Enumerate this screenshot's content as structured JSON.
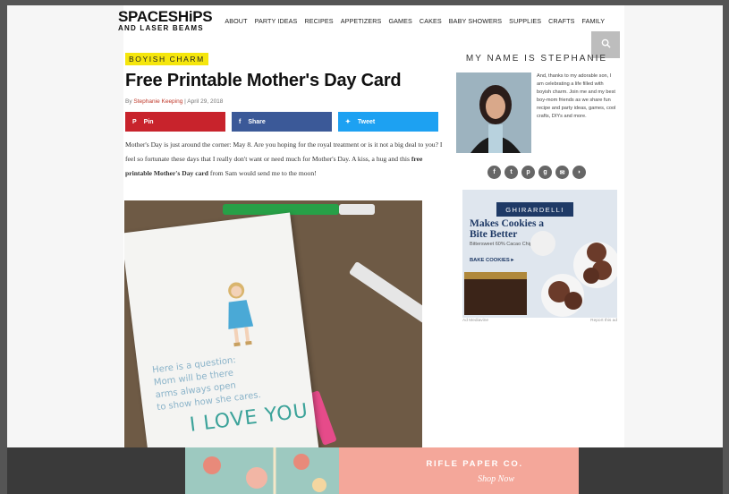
{
  "header": {
    "logo_top": "SPACESHiPS",
    "logo_bottom": "AND LASER BEAMS",
    "nav": [
      "ABOUT",
      "PARTY IDEAS",
      "RECIPES",
      "APPETIZERS",
      "GAMES",
      "CAKES",
      "BABY SHOWERS",
      "SUPPLIES",
      "CRAFTS",
      "FAMILY"
    ]
  },
  "post": {
    "category": "BOYISH CHARM",
    "title": "Free Printable Mother's Day Card",
    "byline_prefix": "By",
    "author": "Stephanie Keeping",
    "date": "April 29, 2018",
    "share": {
      "pin": "Pin",
      "share": "Share",
      "tweet": "Tweet"
    },
    "body_part1": "Mother's Day is just around the corner: May 8. Are you hoping for the royal treatment or is it not a big deal to you?  I feel so fortunate these days that I really don't want or need much for Mother's Day. A kiss, a hug and this ",
    "body_bold": "free printable Mother's Day card",
    "body_part2": " from Sam would send me to the moon!",
    "card_lines": [
      "Here is a question:",
      "Mom will be there",
      "arms always open",
      "to show how she cares."
    ],
    "card_love": "I LOVE YOU"
  },
  "sidebar": {
    "title": "MY NAME IS STEPHANIE",
    "about": "And, thanks to my adorable son, I am celebrating a life filled with boyish charm. Join me and my best boy-mom friends as we share fun recipe and party ideas, games, cool crafts, DIYs and more.",
    "social_icons": [
      "facebook-icon",
      "twitter-icon",
      "pinterest-icon",
      "google-plus-icon",
      "email-icon",
      "rss-icon"
    ]
  },
  "ad": {
    "brand": "GHIRARDELLI",
    "headline": "Makes Cookies a Bite Better",
    "sub": "Bittersweet 60% Cacao Chips",
    "cta": "BAKE COOKIES ▸",
    "foot_left": "Ad Mediavine",
    "foot_right": "Report this ad"
  },
  "banner": {
    "brand": "RIFLE PAPER CO.",
    "cta": "Shop Now"
  }
}
